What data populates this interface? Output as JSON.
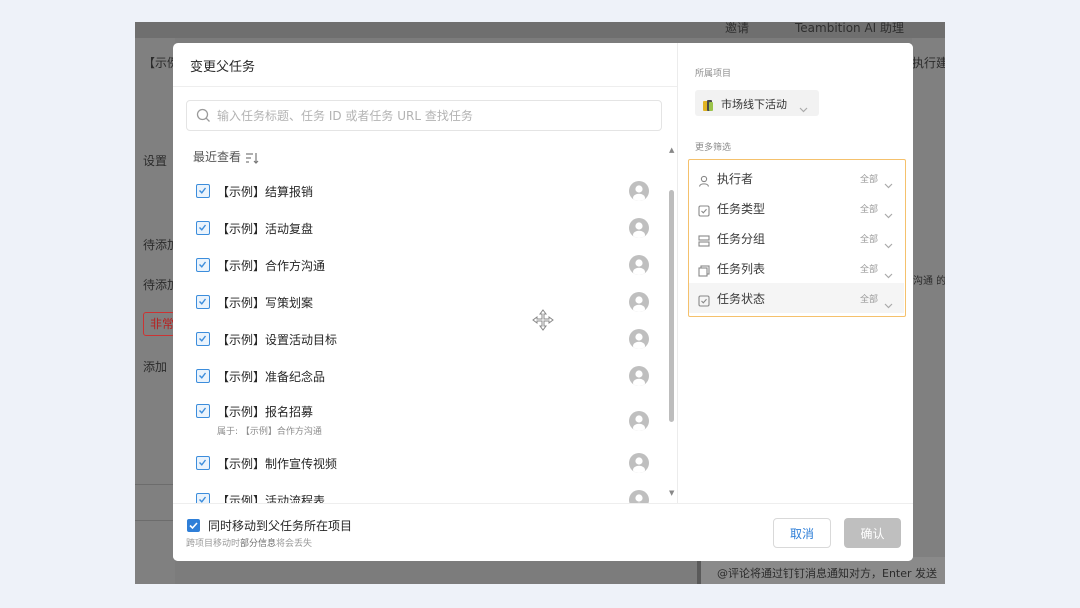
{
  "background": {
    "top_items": [
      "邀请",
      "Teambition AI 助理"
    ],
    "left_texts": [
      "【示例",
      "设置",
      "待添加",
      "待添加",
      "添加"
    ],
    "badge": "非常",
    "right_texts": [
      "执行建",
      "沟通 的"
    ],
    "bottom_text": "@评论将通过钉钉消息通知对方，Enter 发送"
  },
  "dialog": {
    "title": "变更父任务",
    "search_placeholder": "输入任务标题、任务 ID 或者任务 URL 查找任务",
    "recent_label": "最近查看",
    "tasks": [
      {
        "title": "【示例】结算报销",
        "sub": ""
      },
      {
        "title": "【示例】活动复盘",
        "sub": ""
      },
      {
        "title": "【示例】合作方沟通",
        "sub": ""
      },
      {
        "title": "【示例】写策划案",
        "sub": ""
      },
      {
        "title": "【示例】设置活动目标",
        "sub": ""
      },
      {
        "title": "【示例】准备纪念品",
        "sub": ""
      },
      {
        "title": "【示例】报名招募",
        "sub": "属于: 【示例】合作方沟通"
      },
      {
        "title": "【示例】制作宣传视频",
        "sub": ""
      },
      {
        "title": "【示例】活动流程表",
        "sub": ""
      }
    ]
  },
  "side": {
    "project_label": "所属项目",
    "project_name": "市场线下活动",
    "more_label": "更多筛选",
    "filters": [
      {
        "label": "执行者",
        "value": "全部",
        "icon": "user-icon"
      },
      {
        "label": "任务类型",
        "value": "全部",
        "icon": "checkbox-icon"
      },
      {
        "label": "任务分组",
        "value": "全部",
        "icon": "group-icon"
      },
      {
        "label": "任务列表",
        "value": "全部",
        "icon": "list-icon"
      },
      {
        "label": "任务状态",
        "value": "全部",
        "icon": "status-icon"
      }
    ]
  },
  "footer": {
    "checkbox_label": "同时移动到父任务所在项目",
    "hint_before": "跨项目移动时",
    "hint_bold": "部分信息",
    "hint_after": "将会丢失",
    "cancel": "取消",
    "confirm": "确认"
  },
  "colors": {
    "accent": "#2f7fd8",
    "highlight_border": "#f5c16c",
    "disabled": "#bfbfbf"
  }
}
